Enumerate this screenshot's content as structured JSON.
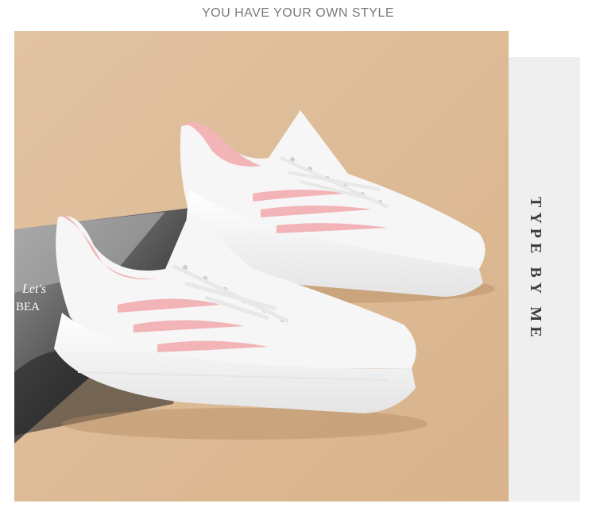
{
  "headline": "YOU HAVE YOUR OWN STYLE",
  "side_vertical_text": "TYPE BY ME",
  "magazine_text": {
    "line1": "Let's",
    "line2": "BEA"
  },
  "colors": {
    "backdrop": "#dfbd97",
    "shoe_white": "#f6f6f6",
    "shoe_pink": "#f2b4b7",
    "side_panel": "#efefef",
    "headline": "#7a7a7a"
  },
  "image_subject": "two-white-pink-knit-sneakers"
}
